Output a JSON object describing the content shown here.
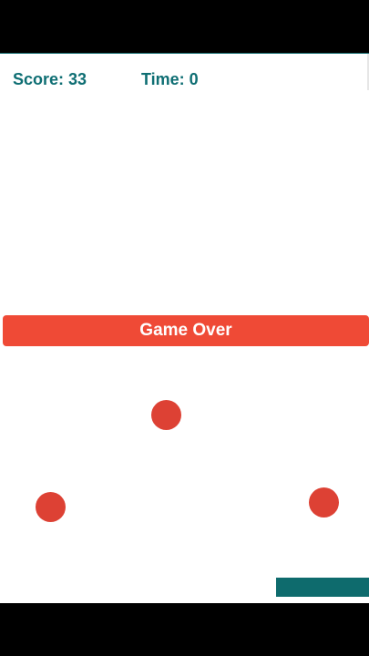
{
  "hud": {
    "score_text": "Score: 33",
    "time_text": "Time: 0",
    "score": 33,
    "time": 0
  },
  "game_over": {
    "label": "Game Over"
  },
  "colors": {
    "hud_text": "#0e6e73",
    "banner": "#ef4a36",
    "ball": "#dd4134",
    "paddle": "#0e6b6d",
    "background": "#ffffff"
  }
}
